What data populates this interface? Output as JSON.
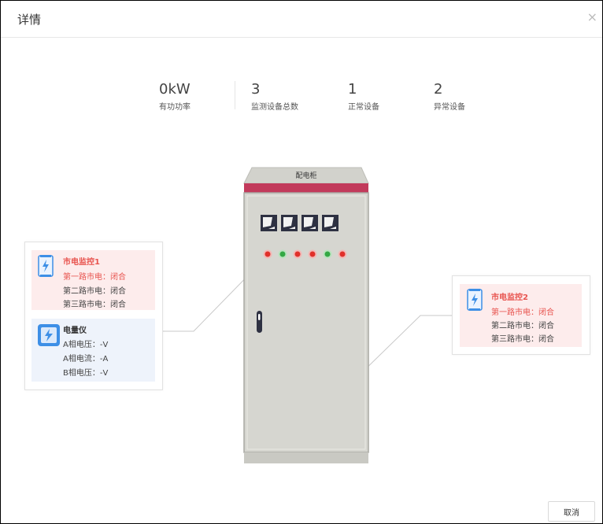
{
  "dialog": {
    "title": "详情",
    "close": "×",
    "cancel_label": "取消"
  },
  "stats": [
    {
      "value": "0kW",
      "label": "有功功率"
    },
    {
      "value": "3",
      "label": "监测设备总数"
    },
    {
      "value": "1",
      "label": "正常设备"
    },
    {
      "value": "2",
      "label": "异常设备"
    }
  ],
  "cabinet": {
    "label": "配电柜"
  },
  "left_card": {
    "monitor": {
      "title": "市电监控1",
      "lines": [
        "第一路市电：闭合",
        "第二路市电：闭合",
        "第三路市电：闭合"
      ]
    },
    "meter": {
      "title": "电量仪",
      "lines": [
        "A相电压：-V",
        "A相电流：-A",
        "B相电压：-V"
      ]
    }
  },
  "right_card": {
    "monitor": {
      "title": "市电监控2",
      "lines": [
        "第一路市电：闭合",
        "第二路市电：闭合",
        "第三路市电：闭合"
      ]
    }
  },
  "colors": {
    "accent_red": "#e8544f",
    "cabinet_band": "#c23a5b",
    "cabinet_body": "#d6d6d0",
    "light_red": "#e0302a",
    "light_green": "#33a844",
    "icon_blue": "#3d8fe6"
  }
}
